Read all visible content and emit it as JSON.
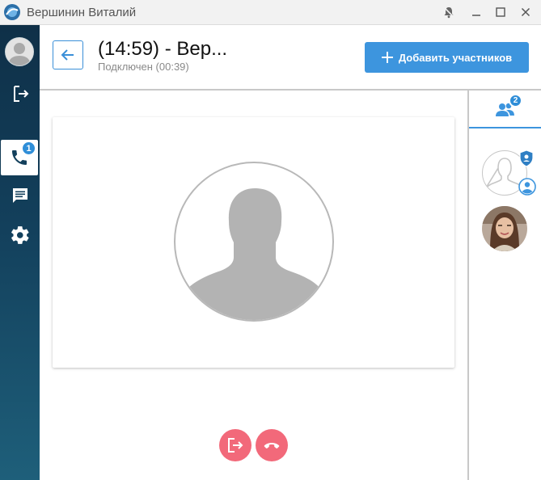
{
  "window": {
    "title": "Вершинин Виталий",
    "controls": [
      "bell-off-icon",
      "minimize-icon",
      "maximize-icon",
      "close-icon"
    ]
  },
  "sidebar": {
    "items": [
      {
        "name": "avatar",
        "icon": "user-icon"
      },
      {
        "name": "logout",
        "icon": "logout-icon"
      },
      {
        "name": "calls",
        "icon": "phone-icon",
        "badge": "1",
        "active": true
      },
      {
        "name": "chat",
        "icon": "chat-icon"
      },
      {
        "name": "settings",
        "icon": "gear-icon"
      }
    ]
  },
  "header": {
    "title": "(14:59) - Вер...",
    "status": "Подключен (00:39)",
    "add_button_label": "Добавить участников"
  },
  "participants_panel": {
    "badge": "2",
    "participants": [
      {
        "type": "placeholder",
        "badges": [
          "shield-icon",
          "person-icon"
        ]
      },
      {
        "type": "photo"
      }
    ]
  },
  "controls": [
    "leave-icon",
    "hangup-icon"
  ],
  "colors": {
    "accent": "#3d95de",
    "danger": "#f2697a",
    "sidebar": "#13405c"
  }
}
